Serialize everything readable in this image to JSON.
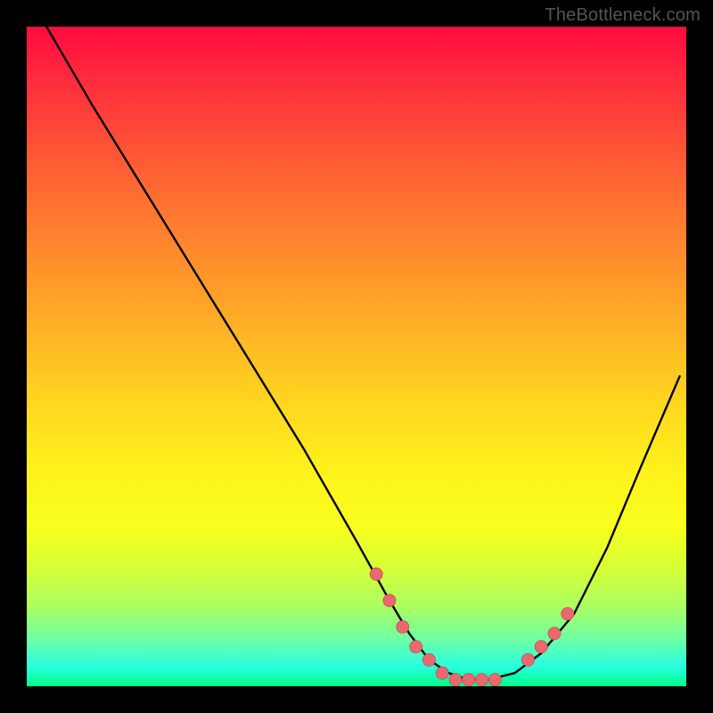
{
  "watermark": "TheBottleneck.com",
  "chart_data": {
    "type": "line",
    "title": "",
    "xlabel": "",
    "ylabel": "",
    "xlim": [
      0,
      100
    ],
    "ylim": [
      0,
      100
    ],
    "grid": false,
    "legend": false,
    "series": [
      {
        "name": "curve",
        "x": [
          3,
          10,
          18,
          26,
          34,
          42,
          50,
          55,
          58,
          61,
          64,
          67,
          70,
          74,
          78,
          83,
          88,
          93,
          99
        ],
        "y": [
          100,
          88,
          75,
          62,
          49,
          36,
          22,
          13,
          8,
          4,
          2,
          1,
          1,
          2,
          5,
          11,
          21,
          33,
          47
        ]
      }
    ],
    "points": {
      "name": "markers",
      "x": [
        53,
        55,
        57,
        59,
        61,
        63,
        65,
        67,
        69,
        71,
        76,
        78,
        80,
        82
      ],
      "y": [
        17,
        13,
        9,
        6,
        4,
        2,
        1,
        1,
        1,
        1,
        4,
        6,
        8,
        11
      ]
    }
  }
}
